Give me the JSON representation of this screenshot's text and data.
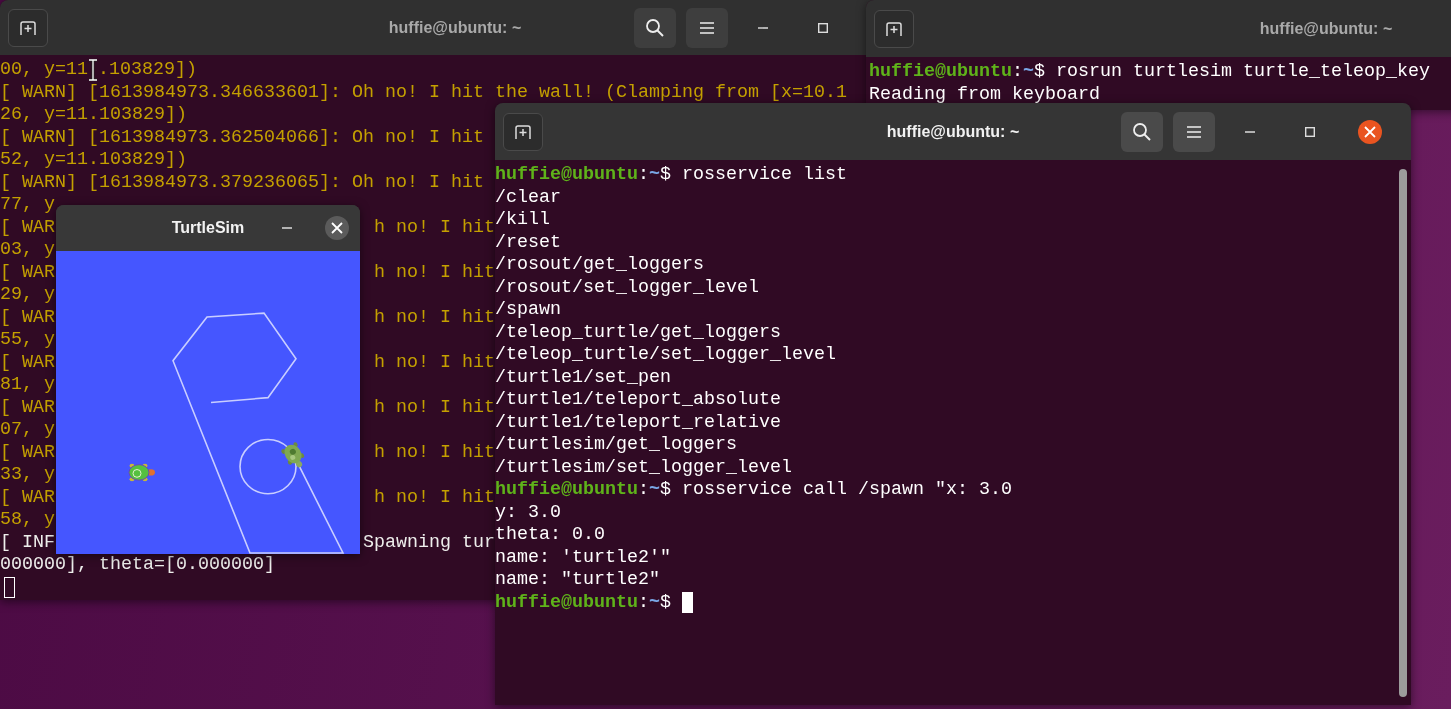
{
  "windows": [
    {
      "kind": "terminal",
      "title": "huffie@ubuntu: ~",
      "active": false,
      "header_buttons": [
        {
          "kind": "new-tab"
        },
        {
          "kind": "search"
        },
        {
          "kind": "menu"
        },
        {
          "kind": "minimize"
        },
        {
          "kind": "maximize"
        }
      ],
      "lines": [
        {
          "kind": "warn",
          "left": "00, y=11",
          "pointer": true,
          "rest": ".103829])"
        },
        {
          "kind": "warn",
          "left": "[ WARN] [1613984973.346633601]: Oh no! I hit the wall! (Clamping from [x=10.1"
        },
        {
          "kind": "warn",
          "left": "26, y=11.103829])"
        },
        {
          "kind": "warn",
          "left": "[ WARN] [1613984973.362504066]: Oh no! I hit"
        },
        {
          "kind": "warn",
          "left": "52, y=11.103829])"
        },
        {
          "kind": "warn",
          "left": "[ WARN] [1613984973.379236065]: Oh no! I hit"
        },
        {
          "kind": "warn",
          "left": "77, y"
        },
        {
          "kind": "warn",
          "left": "[ WAR",
          "right": "h no! I hit"
        },
        {
          "kind": "warn",
          "left": "03, y"
        },
        {
          "kind": "warn",
          "left": "[ WAR",
          "right": "h no! I hit"
        },
        {
          "kind": "warn",
          "left": "29, y"
        },
        {
          "kind": "warn",
          "left": "[ WAR",
          "right": "h no! I hit"
        },
        {
          "kind": "warn",
          "left": "55, y"
        },
        {
          "kind": "warn",
          "left": "[ WAR",
          "right": "h no! I hit"
        },
        {
          "kind": "warn",
          "left": "81, y"
        },
        {
          "kind": "warn",
          "left": "[ WAR",
          "right": "h no! I hit"
        },
        {
          "kind": "warn",
          "left": "07, y"
        },
        {
          "kind": "warn",
          "left": "[ WAR",
          "right": "h no! I hit"
        },
        {
          "kind": "warn",
          "left": "33, y"
        },
        {
          "kind": "warn",
          "left": "[ WAR",
          "right": "h no! I hit"
        },
        {
          "kind": "warn",
          "left": "58, y"
        },
        {
          "kind": "info",
          "left": "[ INF",
          "right": "Spawning tur"
        },
        {
          "kind": "info",
          "left": "000000], theta=[0.000000]"
        },
        {
          "kind": "cursor"
        }
      ]
    },
    {
      "kind": "turtlesim",
      "title": "TurtleSim",
      "header_buttons": [
        {
          "kind": "minimize"
        },
        {
          "kind": "close"
        }
      ]
    },
    {
      "kind": "terminal",
      "title": "huffie@ubuntu: ~",
      "active": false,
      "header_buttons": [
        {
          "kind": "new-tab"
        }
      ],
      "lines": [
        {
          "kind": "prompt",
          "user": "huffie@ubuntu",
          "sep": ":",
          "dir": "~",
          "command": "$ rosrun turtlesim turtle_teleop_key"
        },
        {
          "kind": "output",
          "left": "Reading from keyboard"
        }
      ]
    },
    {
      "kind": "terminal",
      "title": "huffie@ubuntu: ~",
      "active": true,
      "header_buttons": [
        {
          "kind": "new-tab"
        },
        {
          "kind": "search"
        },
        {
          "kind": "menu"
        },
        {
          "kind": "minimize"
        },
        {
          "kind": "maximize"
        },
        {
          "kind": "close"
        }
      ],
      "lines": [
        {
          "kind": "prompt",
          "user": "huffie@ubuntu",
          "sep": ":",
          "dir": "~",
          "command": "$ rosservice list"
        },
        {
          "kind": "output",
          "left": "/clear"
        },
        {
          "kind": "output",
          "left": "/kill"
        },
        {
          "kind": "output",
          "left": "/reset"
        },
        {
          "kind": "output",
          "left": "/rosout/get_loggers"
        },
        {
          "kind": "output",
          "left": "/rosout/set_logger_level"
        },
        {
          "kind": "output",
          "left": "/spawn"
        },
        {
          "kind": "output",
          "left": "/teleop_turtle/get_loggers"
        },
        {
          "kind": "output",
          "left": "/teleop_turtle/set_logger_level"
        },
        {
          "kind": "output",
          "left": "/turtle1/set_pen"
        },
        {
          "kind": "output",
          "left": "/turtle1/teleport_absolute"
        },
        {
          "kind": "output",
          "left": "/turtle1/teleport_relative"
        },
        {
          "kind": "output",
          "left": "/turtlesim/get_loggers"
        },
        {
          "kind": "output",
          "left": "/turtlesim/set_logger_level"
        },
        {
          "kind": "prompt",
          "user": "huffie@ubuntu",
          "sep": ":",
          "dir": "~",
          "command": "$ rosservice call /spawn \"x: 3.0"
        },
        {
          "kind": "output",
          "left": "y: 3.0"
        },
        {
          "kind": "output",
          "left": "theta: 0.0"
        },
        {
          "kind": "output",
          "left": "name: 'turtle2'\""
        },
        {
          "kind": "output",
          "left": "name: \"turtle2\""
        },
        {
          "kind": "prompt",
          "user": "huffie@ubuntu",
          "sep": ":",
          "dir": "~",
          "command": "$",
          "cursor": true
        }
      ]
    }
  ]
}
